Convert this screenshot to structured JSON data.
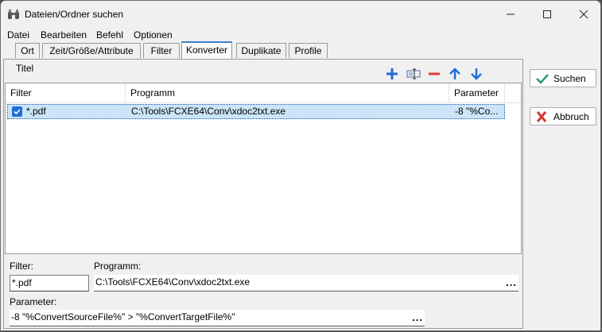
{
  "window": {
    "title": "Dateien/Ordner suchen",
    "icon": "binoculars-icon",
    "controls": [
      "minimize-icon",
      "maximize-icon",
      "close-icon"
    ]
  },
  "menu": [
    "Datei",
    "Bearbeiten",
    "Befehl",
    "Optionen"
  ],
  "tabs": [
    {
      "label": "Ort",
      "active": false
    },
    {
      "label": "Zeit/Größe/Attribute",
      "active": false
    },
    {
      "label": "Filter",
      "active": false
    },
    {
      "label": "Konverter",
      "active": true
    },
    {
      "label": "Duplikate",
      "active": false
    },
    {
      "label": "Profile",
      "active": false
    }
  ],
  "panel": {
    "title": "Titel",
    "toolbar_icons": [
      "plus-icon",
      "edit-field-icon",
      "minus-icon",
      "arrow-up-icon",
      "arrow-down-icon"
    ]
  },
  "list": {
    "columns": [
      "Filter",
      "Programm",
      "Parameter"
    ],
    "rows": [
      {
        "checked": true,
        "filter": "*.pdf",
        "program": "C:\\Tools\\FCXE64\\Conv\\xdoc2txt.exe",
        "parameter": "-8 \"%Co..."
      }
    ]
  },
  "editor": {
    "filter_label": "Filter:",
    "filter_value": "*.pdf",
    "program_label": "Programm:",
    "program_value": "C:\\Tools\\FCXE64\\Conv\\xdoc2txt.exe",
    "parameter_label": "Parameter:",
    "parameter_value": "-8 \"%ConvertSourceFile%\" > \"%ConvertTargetFile%\"",
    "browse_label": "..."
  },
  "buttons": {
    "search_label": "Suchen",
    "cancel_label": "Abbruch"
  },
  "colors": {
    "accent": "#3b7fd1",
    "selection": "#cce4f7",
    "add_icon": "#1f6dd6",
    "remove_icon": "#e03a3a",
    "check_icon": "#2f9e68",
    "cancel_icon": "#d63a2f"
  }
}
